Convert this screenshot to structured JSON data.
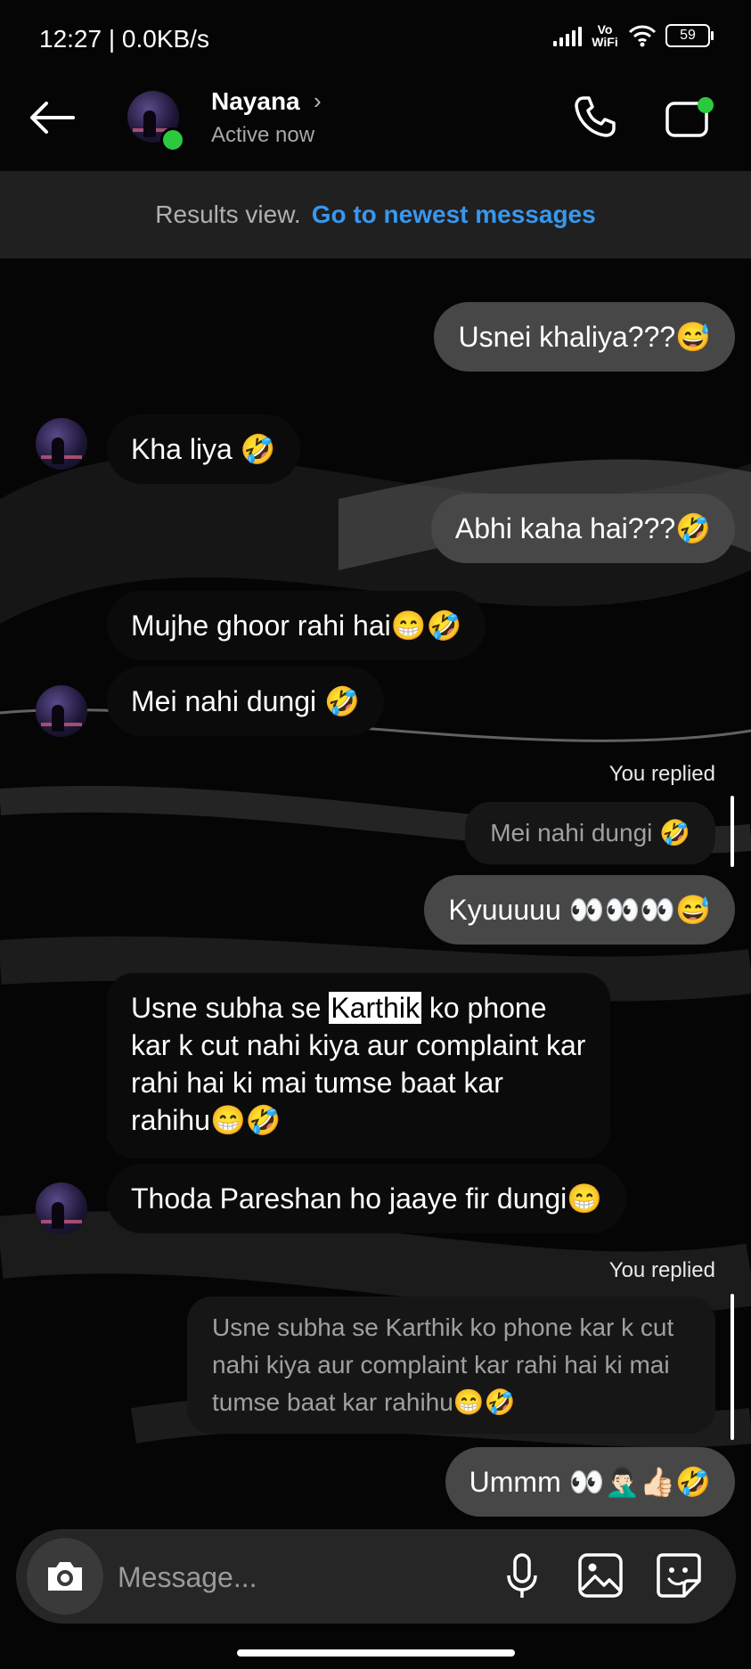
{
  "status_bar": {
    "time": "12:27 | 0.0KB/s",
    "network": "Vo WiFi",
    "battery": "59"
  },
  "header": {
    "name": "Nayana",
    "status": "Active now",
    "back_icon": "arrow-left-icon",
    "call_icon": "phone-icon",
    "video_icon": "video-camera-icon"
  },
  "banner": {
    "text": "Results view.",
    "link": "Go to newest messages"
  },
  "messages": [
    {
      "from": "me",
      "text": "Usnei khaliya???😅"
    },
    {
      "from": "them",
      "text": "Kha liya 🤣"
    },
    {
      "from": "me",
      "text": "Abhi kaha hai???🤣"
    },
    {
      "from": "them",
      "text": "Mujhe ghoor rahi hai😁🤣"
    },
    {
      "from": "them",
      "text": "Mei nahi dungi 🤣"
    },
    {
      "from": "me",
      "reply_label": "You replied",
      "quoted": "Mei nahi dungi 🤣",
      "text": "Kyuuuuu 👀👀👀😅"
    },
    {
      "from": "them",
      "text_before": "Usne subha se",
      "text_highlight": "Karthik",
      "text_after": "ko phone kar k cut nahi kiya aur complaint kar rahi hai ki mai tumse baat kar rahihu😁🤣"
    },
    {
      "from": "them",
      "text": "Thoda Pareshan ho jaaye fir dungi😁"
    },
    {
      "from": "me",
      "reply_label": "You replied",
      "quoted": "Usne subha se Karthik ko phone kar k cut nahi kiya aur complaint kar rahi hai ki mai tumse baat kar rahihu😁🤣",
      "text": "Ummm 👀🤦🏻‍♂️👍🏻🤣"
    }
  ],
  "composer": {
    "placeholder": "Message...",
    "icons": [
      "camera-icon",
      "microphone-icon",
      "gallery-icon",
      "sticker-icon"
    ]
  },
  "colors": {
    "background": "#000000",
    "sent_bubble": "#474747",
    "received_bubble": "#0b0b0b",
    "link": "#3897f0",
    "online": "#2bc940"
  }
}
